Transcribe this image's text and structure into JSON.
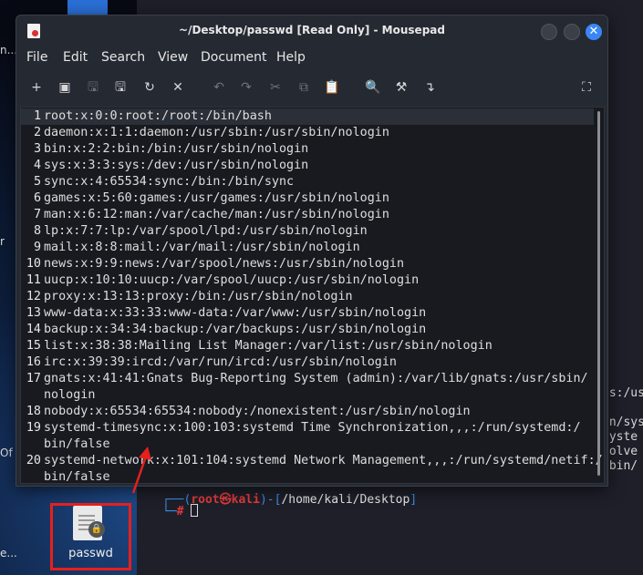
{
  "window": {
    "title": "~/Desktop/passwd [Read Only] - Mousepad",
    "close_glyph": "✕"
  },
  "menu": [
    "File",
    "Edit",
    "Search",
    "View",
    "Document",
    "Help"
  ],
  "toolbar": [
    {
      "icon": "new-document-icon",
      "glyph": "+"
    },
    {
      "icon": "new-window-icon",
      "glyph": "▣"
    },
    {
      "icon": "save-icon",
      "glyph": "🖫"
    },
    {
      "icon": "save-as-icon",
      "glyph": "🖫"
    },
    {
      "icon": "reload-icon",
      "glyph": "↻"
    },
    {
      "icon": "close-document-icon",
      "glyph": "✕"
    },
    {
      "icon": "undo-icon",
      "glyph": "↶"
    },
    {
      "icon": "redo-icon",
      "glyph": "↷"
    },
    {
      "icon": "cut-icon",
      "glyph": "✂"
    },
    {
      "icon": "copy-icon",
      "glyph": "⧉"
    },
    {
      "icon": "paste-icon",
      "glyph": "📋"
    },
    {
      "icon": "find-icon",
      "glyph": "🔍"
    },
    {
      "icon": "find-replace-icon",
      "glyph": "⚒"
    },
    {
      "icon": "goto-icon",
      "glyph": "↴"
    },
    {
      "icon": "fullscreen-icon",
      "glyph": "⛶"
    }
  ],
  "editor": {
    "lines": [
      {
        "num": "1",
        "text": "root:x:0:0:root:/root:/bin/bash"
      },
      {
        "num": "2",
        "text": "daemon:x:1:1:daemon:/usr/sbin:/usr/sbin/nologin"
      },
      {
        "num": "3",
        "text": "bin:x:2:2:bin:/bin:/usr/sbin/nologin"
      },
      {
        "num": "4",
        "text": "sys:x:3:3:sys:/dev:/usr/sbin/nologin"
      },
      {
        "num": "5",
        "text": "sync:x:4:65534:sync:/bin:/bin/sync"
      },
      {
        "num": "6",
        "text": "games:x:5:60:games:/usr/games:/usr/sbin/nologin"
      },
      {
        "num": "7",
        "text": "man:x:6:12:man:/var/cache/man:/usr/sbin/nologin"
      },
      {
        "num": "8",
        "text": "lp:x:7:7:lp:/var/spool/lpd:/usr/sbin/nologin"
      },
      {
        "num": "9",
        "text": "mail:x:8:8:mail:/var/mail:/usr/sbin/nologin"
      },
      {
        "num": "10",
        "text": "news:x:9:9:news:/var/spool/news:/usr/sbin/nologin"
      },
      {
        "num": "11",
        "text": "uucp:x:10:10:uucp:/var/spool/uucp:/usr/sbin/nologin"
      },
      {
        "num": "12",
        "text": "proxy:x:13:13:proxy:/bin:/usr/sbin/nologin"
      },
      {
        "num": "13",
        "text": "www-data:x:33:33:www-data:/var/www:/usr/sbin/nologin"
      },
      {
        "num": "14",
        "text": "backup:x:34:34:backup:/var/backups:/usr/sbin/nologin"
      },
      {
        "num": "15",
        "text": "list:x:38:38:Mailing List Manager:/var/list:/usr/sbin/nologin"
      },
      {
        "num": "16",
        "text": "irc:x:39:39:ircd:/var/run/ircd:/usr/sbin/nologin"
      },
      {
        "num": "17",
        "text": "gnats:x:41:41:Gnats Bug-Reporting System (admin):/var/lib/gnats:/usr/sbin/"
      },
      {
        "num": "",
        "text": "nologin"
      },
      {
        "num": "18",
        "text": "nobody:x:65534:65534:nobody:/nonexistent:/usr/sbin/nologin"
      },
      {
        "num": "19",
        "text": "systemd-timesync:x:100:103:systemd Time Synchronization,,,:/run/systemd:/"
      },
      {
        "num": "",
        "text": "bin/false"
      },
      {
        "num": "20",
        "text": "systemd-network:x:101:104:systemd Network Management,,,:/run/systemd/netif:/"
      },
      {
        "num": "",
        "text": "bin/false"
      }
    ]
  },
  "terminal": {
    "prompt_user": "root",
    "prompt_sep": "㉿",
    "prompt_host": "kali",
    "prompt_path": "/home/kali/Desktop",
    "prompt_hash": "#",
    "right_fragments": [
      "ts:/us",
      "un/sys",
      "syste",
      "solve",
      "/bin/"
    ]
  },
  "desktop": {
    "file_label": "passwd",
    "left_fragments": [
      "n...",
      "r",
      "Of",
      "e..."
    ]
  },
  "colors": {
    "annotation": "#e5201d",
    "accent": "#3a86f5"
  }
}
